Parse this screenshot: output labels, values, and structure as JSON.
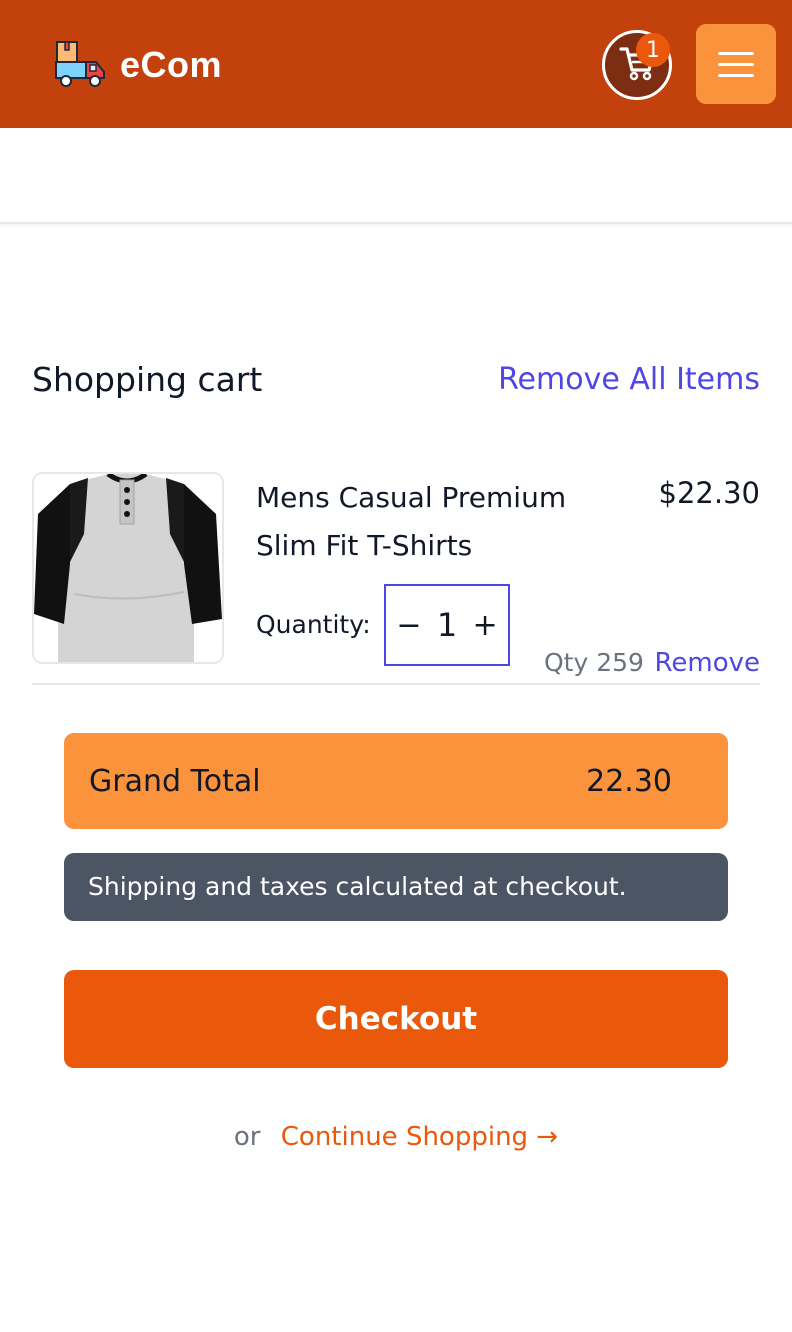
{
  "header": {
    "brand": "eCom",
    "cart_count": "1",
    "brand_color": "#c2410c",
    "menu_color": "#fb923c"
  },
  "cart": {
    "title": "Shopping cart",
    "remove_all": "Remove All Items",
    "items": [
      {
        "name": "Mens Casual Premium Slim Fit T-Shirts",
        "price": "$22.30",
        "quantity_label": "Quantity:",
        "quantity": "1",
        "stock": "Qty 259",
        "remove": "Remove"
      }
    ]
  },
  "summary": {
    "grand_total_label": "Grand Total",
    "grand_total_value": "22.30",
    "notice": "Shipping and taxes calculated at checkout.",
    "checkout": "Checkout",
    "or": "or",
    "continue": "Continue Shopping →"
  },
  "colors": {
    "accent": "#ea580c",
    "link": "#4f46e5",
    "notice_bg": "#4b5563"
  },
  "icons": {
    "logo": "delivery-truck-icon",
    "cart": "shopping-cart-icon",
    "menu": "hamburger-menu-icon",
    "minus": "minus-icon",
    "plus": "plus-icon"
  }
}
